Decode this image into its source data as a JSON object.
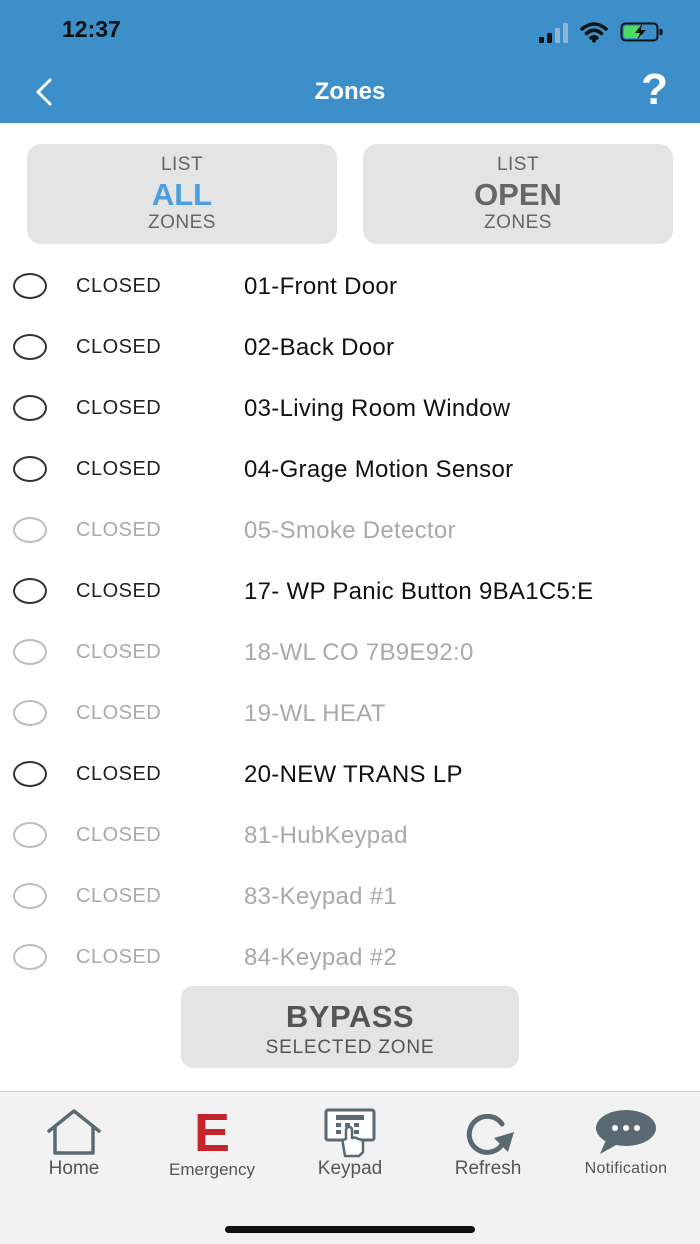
{
  "status_bar": {
    "time": "12:37"
  },
  "header": {
    "title": "Zones",
    "help": "?"
  },
  "filters": {
    "all": {
      "top": "LIST",
      "main": "ALL",
      "bottom": "ZONES"
    },
    "open": {
      "top": "LIST",
      "main": "OPEN",
      "bottom": "ZONES"
    }
  },
  "zones": [
    {
      "status": "CLOSED",
      "name": "01-Front Door",
      "enabled": true
    },
    {
      "status": "CLOSED",
      "name": "02-Back Door",
      "enabled": true
    },
    {
      "status": "CLOSED",
      "name": "03-Living Room Window",
      "enabled": true
    },
    {
      "status": "CLOSED",
      "name": "04-Grage Motion Sensor",
      "enabled": true
    },
    {
      "status": "CLOSED",
      "name": "05-Smoke Detector",
      "enabled": false
    },
    {
      "status": "CLOSED",
      "name": "17- WP Panic Button 9BA1C5:E",
      "enabled": true
    },
    {
      "status": "CLOSED",
      "name": "18-WL CO 7B9E92:0",
      "enabled": false
    },
    {
      "status": "CLOSED",
      "name": "19-WL HEAT",
      "enabled": false
    },
    {
      "status": "CLOSED",
      "name": "20-NEW TRANS LP",
      "enabled": true
    },
    {
      "status": "CLOSED",
      "name": "81-HubKeypad",
      "enabled": false
    },
    {
      "status": "CLOSED",
      "name": "83-Keypad #1",
      "enabled": false
    },
    {
      "status": "CLOSED",
      "name": "84-Keypad #2",
      "enabled": false
    }
  ],
  "bypass": {
    "main": "BYPASS",
    "sub": "SELECTED ZONE"
  },
  "nav": {
    "home": "Home",
    "emergency": "Emergency",
    "emergency_glyph": "E",
    "keypad": "Keypad",
    "refresh": "Refresh",
    "notification": "Notification"
  },
  "colors": {
    "header_bg": "#3d8fca",
    "accent_blue": "#4b9ee0",
    "emergency_red": "#c4252d",
    "disabled_text": "#a9a9a9"
  }
}
